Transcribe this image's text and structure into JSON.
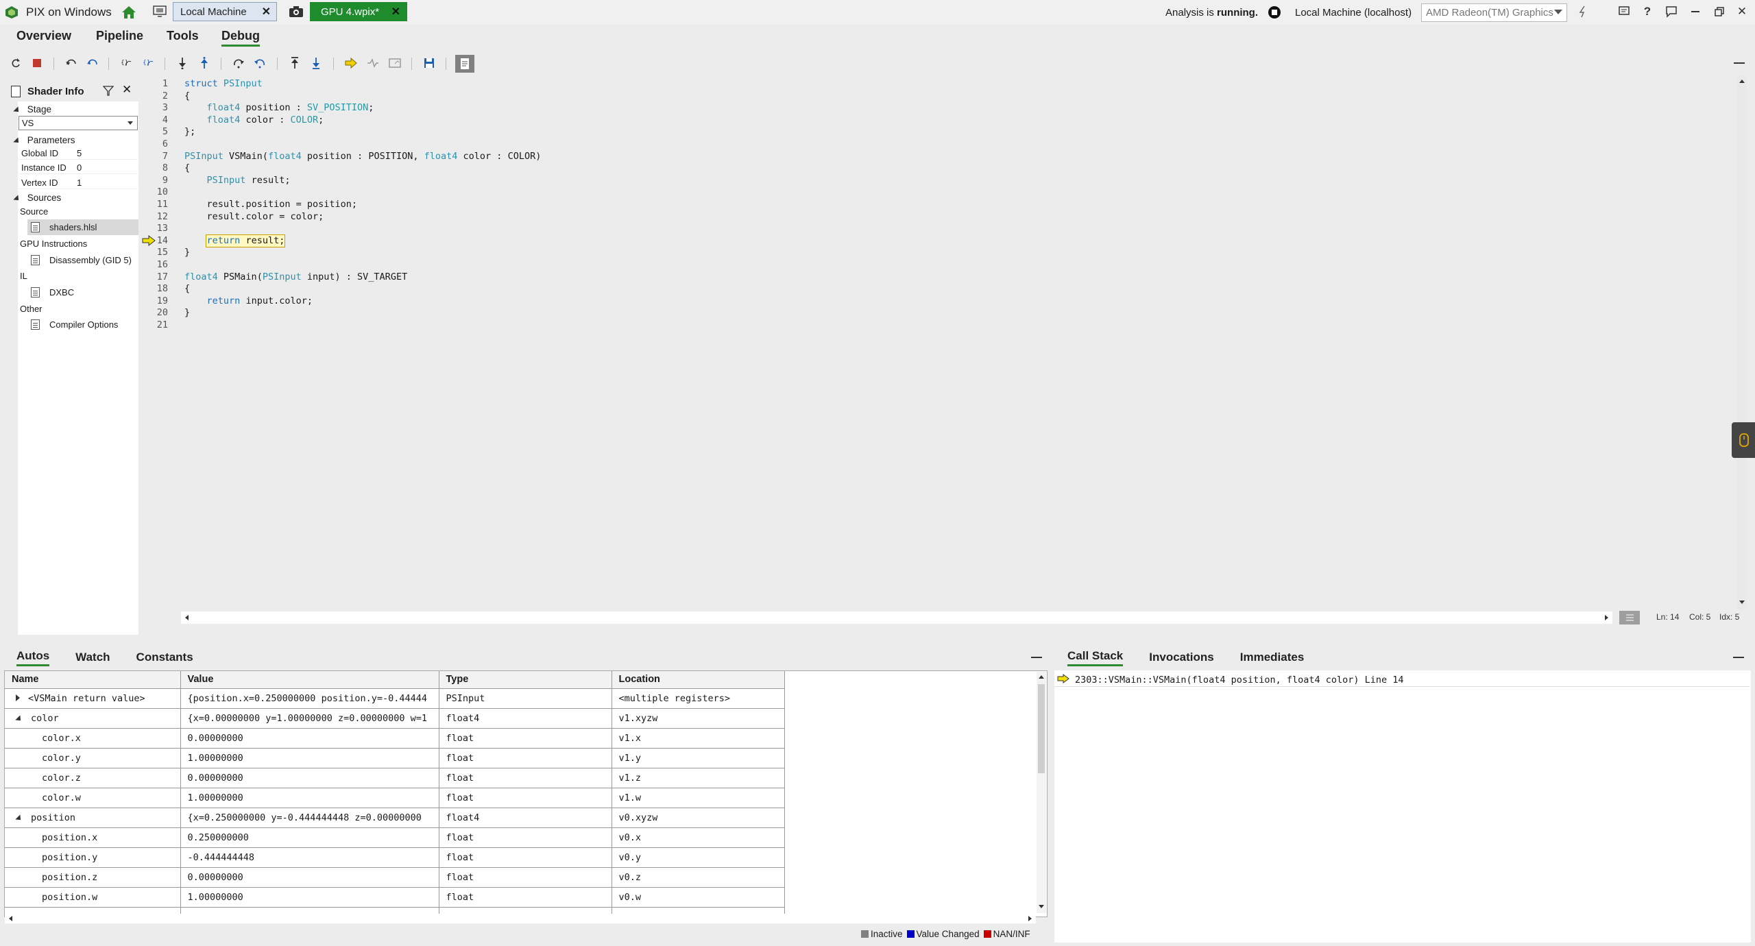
{
  "app": {
    "title": "PIX on Windows"
  },
  "tabs": {
    "machine": "Local Machine",
    "capture": "GPU 4.wpix*"
  },
  "titlebar": {
    "analysis_prefix": "Analysis is ",
    "analysis_state": "running.",
    "connection": "Local Machine (localhost)",
    "gpu": "AMD Radeon(TM) Graphics"
  },
  "menu": [
    "Overview",
    "Pipeline",
    "Tools",
    "Debug"
  ],
  "shader_info": {
    "title": "Shader Info",
    "stage_label": "Stage",
    "stage_value": "VS",
    "parameters_label": "Parameters",
    "params": [
      {
        "name": "Global ID",
        "value": "5"
      },
      {
        "name": "Instance ID",
        "value": "0"
      },
      {
        "name": "Vertex ID",
        "value": "1"
      }
    ],
    "sources_label": "Sources",
    "groups": {
      "source": "Source",
      "source_file": "shaders.hlsl",
      "gpu_instr": "GPU Instructions",
      "disasm": "Disassembly (GID 5)",
      "il": "IL",
      "dxbc": "DXBC",
      "other": "Other",
      "compiler": "Compiler Options"
    }
  },
  "code": {
    "lines": [
      "struct PSInput",
      "{",
      "    float4 position : SV_POSITION;",
      "    float4 color : COLOR;",
      "};",
      "",
      "PSInput VSMain(float4 position : POSITION, float4 color : COLOR)",
      "{",
      "    PSInput result;",
      "",
      "    result.position = position;",
      "    result.color = color;",
      "",
      "    return result;",
      "}",
      "",
      "float4 PSMain(PSInput input) : SV_TARGET",
      "{",
      "    return input.color;",
      "}",
      ""
    ],
    "current_line": 14
  },
  "editor_status": {
    "ln": "Ln: 14",
    "col": "Col: 5",
    "idx": "Idx: 5"
  },
  "bottom_left_tabs": [
    "Autos",
    "Watch",
    "Constants"
  ],
  "bottom_right_tabs": [
    "Call Stack",
    "Invocations",
    "Immediates"
  ],
  "autos": {
    "columns": [
      "Name",
      "Value",
      "Type",
      "Location"
    ],
    "rows": [
      {
        "name": "<VSMain return value>",
        "value": "{position.x=0.250000000 position.y=-0.44444",
        "type": "PSInput",
        "loc": "<multiple registers>"
      },
      {
        "name": "color",
        "value": "{x=0.00000000 y=1.00000000 z=0.00000000 w=1",
        "type": "float4",
        "loc": "v1.xyzw"
      },
      {
        "name": "color.x",
        "value": "0.00000000",
        "type": "float",
        "loc": "v1.x"
      },
      {
        "name": "color.y",
        "value": "1.00000000",
        "type": "float",
        "loc": "v1.y"
      },
      {
        "name": "color.z",
        "value": "0.00000000",
        "type": "float",
        "loc": "v1.z"
      },
      {
        "name": "color.w",
        "value": "1.00000000",
        "type": "float",
        "loc": "v1.w"
      },
      {
        "name": "position",
        "value": "{x=0.250000000 y=-0.444444448 z=0.00000000",
        "type": "float4",
        "loc": "v0.xyzw"
      },
      {
        "name": "position.x",
        "value": "0.250000000",
        "type": "float",
        "loc": "v0.x"
      },
      {
        "name": "position.y",
        "value": "-0.444444448",
        "type": "float",
        "loc": "v0.y"
      },
      {
        "name": "position.z",
        "value": "0.00000000",
        "type": "float",
        "loc": "v0.z"
      },
      {
        "name": "position.w",
        "value": "1.00000000",
        "type": "float",
        "loc": "v0.w"
      }
    ]
  },
  "legend": {
    "inactive": "Inactive",
    "changed": "Value Changed",
    "nan": "NAN/INF"
  },
  "callstack": {
    "frame": "2303::VSMain::VSMain(float4 position, float4 color) Line 14"
  },
  "colors": {
    "accent": "#2d8a2d",
    "capture_tab": "#1e8b2c",
    "current_arrow": "#f0e000"
  }
}
